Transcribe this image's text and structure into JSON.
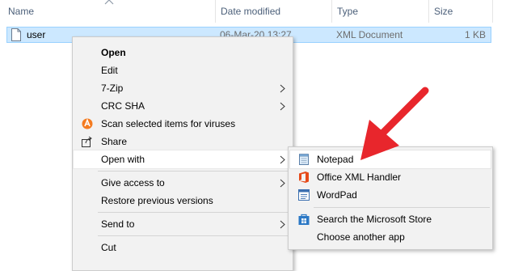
{
  "columns": {
    "name": "Name",
    "date_modified": "Date modified",
    "type": "Type",
    "size": "Size"
  },
  "file": {
    "name": "user",
    "date": "06-Mar-20 13:27",
    "type": "XML Document",
    "size": "1 KB",
    "icon": "document-icon"
  },
  "context_menu": {
    "items": [
      {
        "label": "Open",
        "bold": true
      },
      {
        "label": "Edit"
      },
      {
        "label": "7-Zip",
        "submenu": true
      },
      {
        "label": "CRC SHA",
        "submenu": true
      },
      {
        "label": "Scan selected items for viruses",
        "icon": "avast-icon"
      },
      {
        "label": "Share",
        "icon": "share-icon"
      },
      {
        "label": "Open with",
        "submenu": true,
        "highlighted": true
      },
      {
        "label": "Give access to",
        "submenu": true
      },
      {
        "label": "Restore previous versions"
      },
      {
        "label": "Send to",
        "submenu": true
      },
      {
        "label": "Cut"
      }
    ]
  },
  "open_with_menu": {
    "items": [
      {
        "label": "Notepad",
        "icon": "notepad-icon",
        "highlighted": true
      },
      {
        "label": "Office XML Handler",
        "icon": "office-icon"
      },
      {
        "label": "WordPad",
        "icon": "wordpad-icon"
      },
      {
        "label": "Search the Microsoft Store",
        "icon": "store-icon"
      },
      {
        "label": "Choose another app"
      }
    ]
  },
  "colors": {
    "selection": "#cce8ff",
    "menu_bg": "#f2f2f2",
    "arrow": "#e8262c"
  }
}
